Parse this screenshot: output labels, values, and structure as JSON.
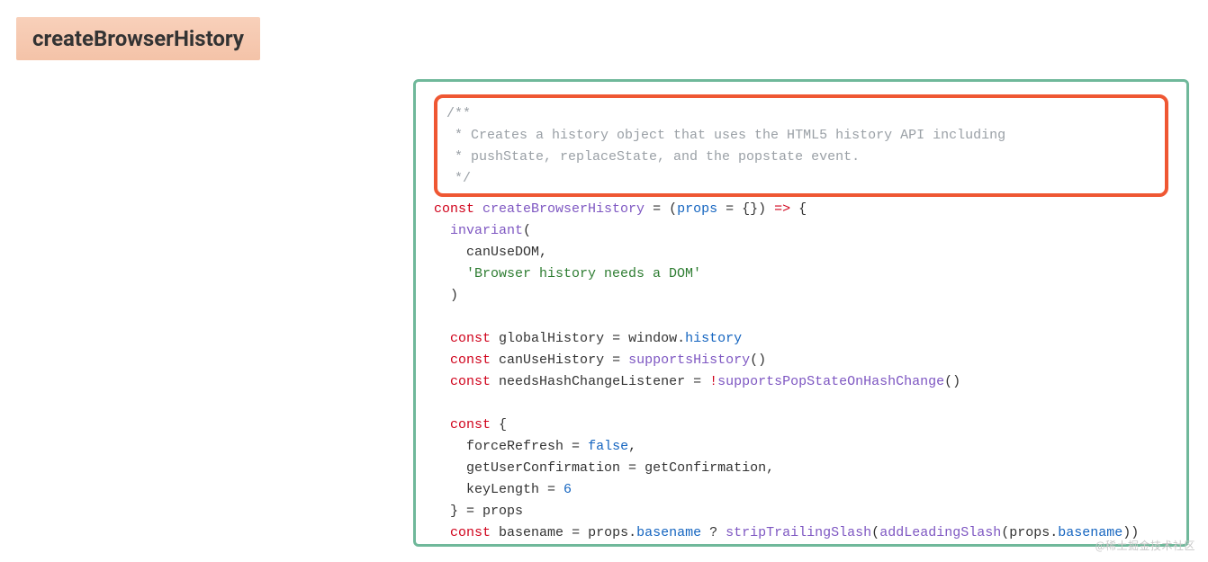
{
  "title": "createBrowserHistory",
  "watermark": "@稀土掘金技术社区",
  "comment": {
    "l1": "/**",
    "l2": " * Creates a history object that uses the HTML5 history API including",
    "l3": " * pushState, replaceState, and the popstate event.",
    "l4": " */"
  },
  "code": {
    "kw_const": "const",
    "fn_name": "createBrowserHistory",
    "eq": " = ",
    "params_open": "(",
    "props": "props",
    "default_empty": " = {}) ",
    "arrow": "=>",
    "brace_open": " {",
    "invariant": "invariant",
    "paren_open": "(",
    "canUseDOM": "canUseDOM",
    "comma": ",",
    "dom_str": "'Browser history needs a DOM'",
    "paren_close": ")",
    "globalHistory": "globalHistory",
    "window": "window",
    "dot": ".",
    "history": "history",
    "canUseHistory": "canUseHistory",
    "supportsHistory": "supportsHistory",
    "empty_call": "()",
    "needsHash": "needsHashChangeListener",
    "bang": "!",
    "supportsPop": "supportsPopStateOnHashChange",
    "destruct_open": "{",
    "forceRefresh": "forceRefresh",
    "false": "false",
    "getUserConfirmation": "getUserConfirmation",
    "getConfirmation": "getConfirmation",
    "keyLength": "keyLength",
    "six": "6",
    "destruct_close": "}",
    "eq_props": " = props",
    "basename": "basename",
    "eq2": " = ",
    "props2": "props",
    "question": " ? ",
    "stripTrailing": "stripTrailingSlash",
    "addLeading": "addLeadingSlash",
    "end_paren": "))"
  }
}
